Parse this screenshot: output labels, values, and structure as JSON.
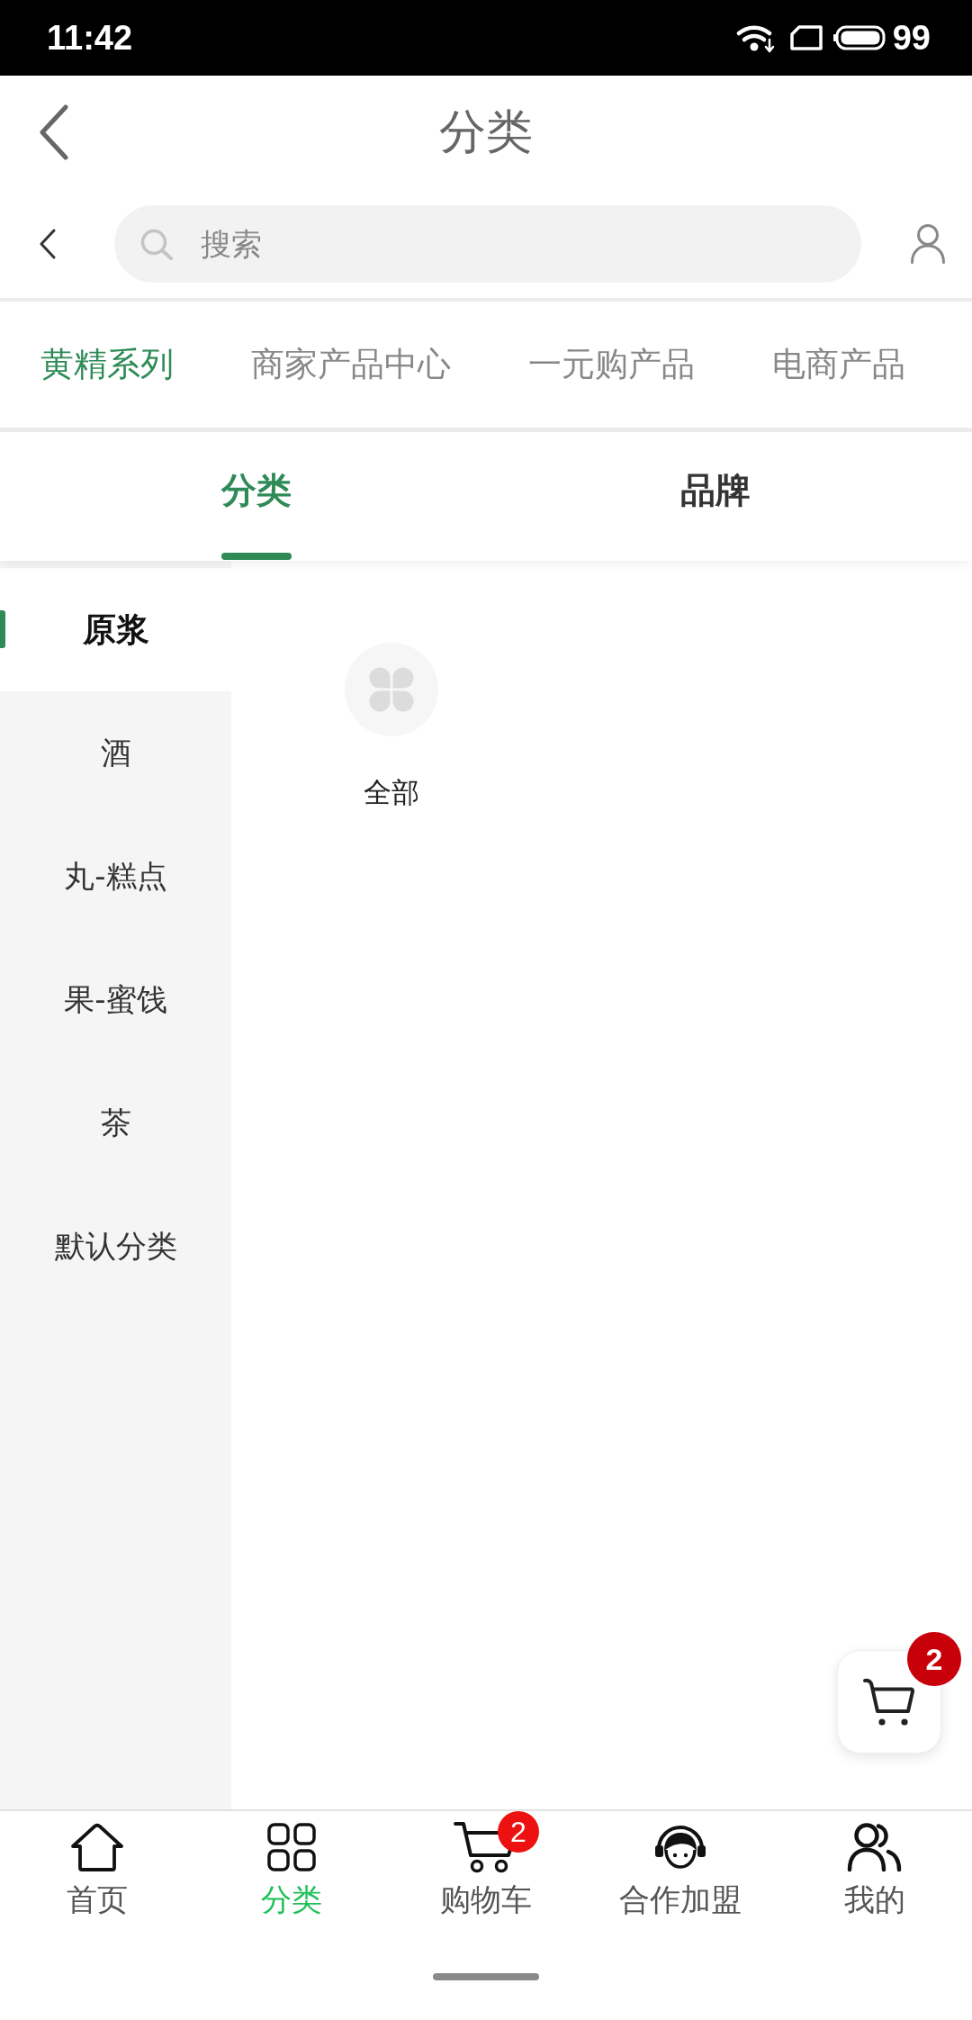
{
  "status_bar": {
    "time": "11:42",
    "battery": "99"
  },
  "header": {
    "title": "分类"
  },
  "search": {
    "placeholder": "搜索"
  },
  "category_tabs": [
    {
      "label": "黄精系列",
      "selected": true
    },
    {
      "label": "商家产品中心",
      "selected": false
    },
    {
      "label": "一元购产品",
      "selected": false
    },
    {
      "label": "电商产品",
      "selected": false
    }
  ],
  "view_tabs": [
    {
      "label": "分类",
      "selected": true
    },
    {
      "label": "品牌",
      "selected": false
    }
  ],
  "sidebar": {
    "items": [
      {
        "label": "原浆",
        "selected": true
      },
      {
        "label": "酒",
        "selected": false
      },
      {
        "label": "丸-糕点",
        "selected": false
      },
      {
        "label": "果-蜜饯",
        "selected": false
      },
      {
        "label": "茶",
        "selected": false
      },
      {
        "label": "默认分类",
        "selected": false
      }
    ]
  },
  "subcategories": [
    {
      "label": "全部"
    }
  ],
  "floating_cart": {
    "badge": "2"
  },
  "bottom_nav": [
    {
      "kind": "home",
      "label": "首页",
      "selected": false
    },
    {
      "kind": "grid",
      "label": "分类",
      "selected": true
    },
    {
      "kind": "cart",
      "label": "购物车",
      "selected": false,
      "badge": "2"
    },
    {
      "kind": "headset",
      "label": "合作加盟",
      "selected": false
    },
    {
      "kind": "people",
      "label": "我的",
      "selected": false
    }
  ]
}
